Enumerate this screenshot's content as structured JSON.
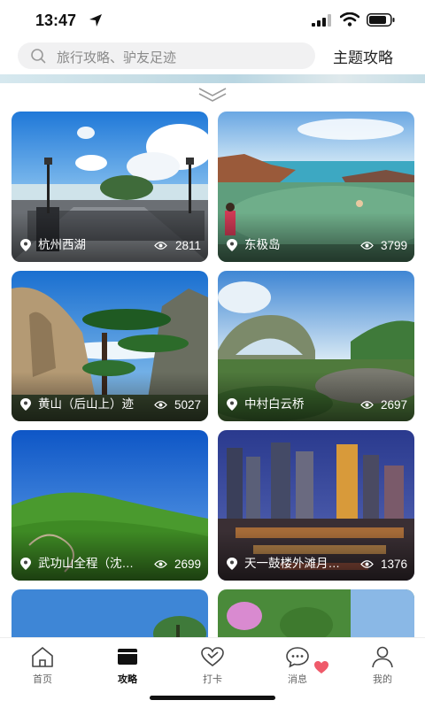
{
  "status": {
    "time": "13:47"
  },
  "search": {
    "placeholder": "旅行攻略、驴友足迹",
    "theme_link": "主题攻略"
  },
  "cards": [
    {
      "title": "杭州西湖",
      "views": "2811",
      "photo_icon": "west-lake-photo"
    },
    {
      "title": "东极岛",
      "views": "3799",
      "photo_icon": "dongji-island-photo"
    },
    {
      "title": "黄山（后山上）迹",
      "views": "5027",
      "photo_icon": "huangshan-photo"
    },
    {
      "title": "中村白云桥",
      "views": "2697",
      "photo_icon": "baiyun-bridge-photo"
    },
    {
      "title": "武功山全程（沈…",
      "views": "2699",
      "photo_icon": "wugong-mountain-photo"
    },
    {
      "title": "天一鼓楼外滩月…",
      "views": "1376",
      "photo_icon": "city-night-photo"
    },
    {
      "title": "",
      "views": "",
      "photo_icon": "sky-tree-photo"
    },
    {
      "title": "",
      "views": "",
      "photo_icon": "flower-mountain-photo"
    }
  ],
  "tabs": [
    {
      "label": "首页",
      "icon": "home-icon",
      "active": false
    },
    {
      "label": "攻略",
      "icon": "guide-icon",
      "active": true
    },
    {
      "label": "打卡",
      "icon": "checkin-heart-icon",
      "active": false
    },
    {
      "label": "消息",
      "icon": "message-icon",
      "active": false
    },
    {
      "label": "我的",
      "icon": "profile-icon",
      "active": false
    }
  ],
  "colors": {
    "accent": "#111111",
    "badge": "#ef5a6a"
  }
}
